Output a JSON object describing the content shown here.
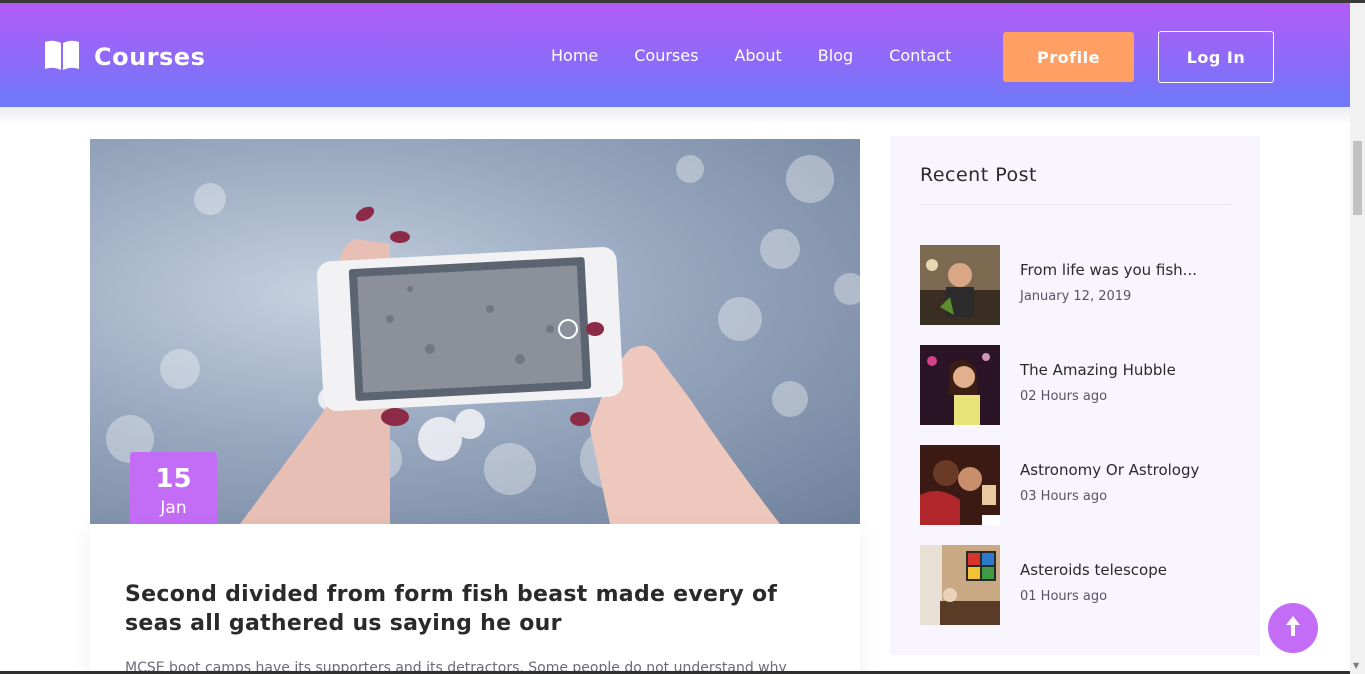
{
  "brand": {
    "name": "Courses"
  },
  "nav": {
    "links": [
      "Home",
      "Courses",
      "About",
      "Blog",
      "Contact"
    ],
    "profile_label": "Profile",
    "login_label": "Log In"
  },
  "post": {
    "date_day": "15",
    "date_month": "Jan",
    "title": "Second divided from form fish beast made every of seas all gathered us saying he our",
    "excerpt": "MCSE boot camps have its supporters and its detractors. Some people do not understand why"
  },
  "sidebar": {
    "title": "Recent Post",
    "items": [
      {
        "title": "From life was you fish...",
        "date": "January 12, 2019"
      },
      {
        "title": "The Amazing Hubble",
        "date": "02 Hours ago"
      },
      {
        "title": "Astronomy Or Astrology",
        "date": "03 Hours ago"
      },
      {
        "title": "Asteroids telescope",
        "date": "01 Hours ago"
      }
    ]
  },
  "colors": {
    "nav_gradient_top": "#b25cf8",
    "nav_gradient_bottom": "#6e7bf8",
    "accent_purple": "#c36cf6",
    "profile_orange": "#ff9f63",
    "sidebar_bg": "#f9f5ff"
  },
  "icons": {
    "brand": "open-book-icon",
    "back_to_top": "arrow-up-icon"
  }
}
